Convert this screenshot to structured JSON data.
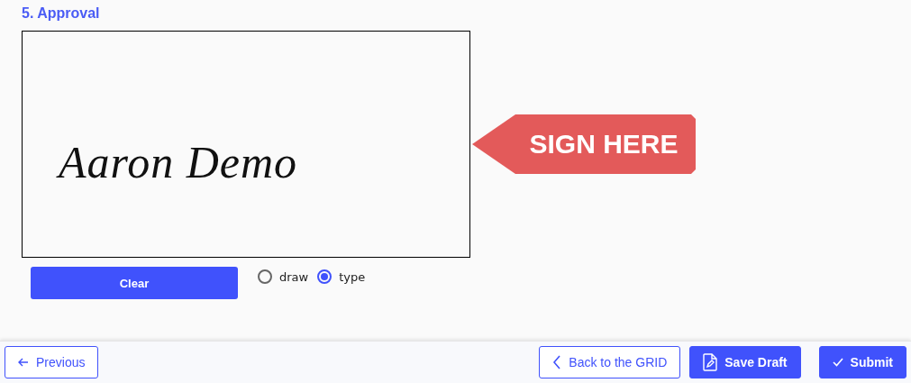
{
  "section": {
    "title": "5. Approval"
  },
  "signature": {
    "value": "Aaron Demo"
  },
  "callout": {
    "label": "SIGN HERE"
  },
  "clear_button": {
    "label": "Clear"
  },
  "modes": [
    {
      "label": "draw",
      "selected": false
    },
    {
      "label": "type",
      "selected": true
    }
  ],
  "footer": {
    "buttons": [
      {
        "kind": "previous",
        "label": "Previous"
      },
      {
        "kind": "back",
        "label": "Back to the GRID"
      },
      {
        "kind": "draft",
        "label": "Save Draft"
      },
      {
        "kind": "submit",
        "label": "Submit"
      }
    ]
  }
}
